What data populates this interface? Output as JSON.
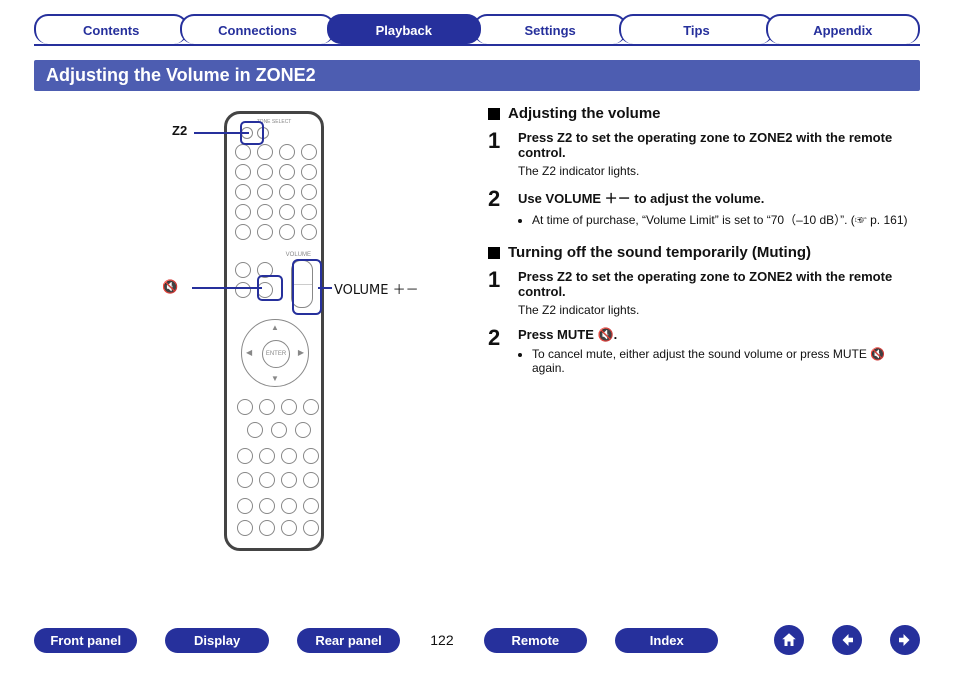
{
  "tabs": {
    "items": [
      {
        "label": "Contents",
        "active": false
      },
      {
        "label": "Connections",
        "active": false
      },
      {
        "label": "Playback",
        "active": true
      },
      {
        "label": "Settings",
        "active": false
      },
      {
        "label": "Tips",
        "active": false
      },
      {
        "label": "Appendix",
        "active": false
      }
    ]
  },
  "title": "Adjusting the Volume in ZONE2",
  "illustration": {
    "z2_label": "Z2",
    "volume_label": "VOLUME ＋－",
    "mute_glyph": "🔇"
  },
  "section_a": {
    "heading": "Adjusting the volume",
    "step1": {
      "num": "1",
      "title": "Press Z2 to set the operating zone to ZONE2 with the remote control.",
      "desc": "The Z2 indicator lights."
    },
    "step2": {
      "num": "2",
      "title": "Use VOLUME ＋－ to adjust the volume.",
      "note": "At time of purchase, “Volume Limit” is set to “70（–10 dB）”. (☞ p. 161)"
    }
  },
  "section_b": {
    "heading": "Turning off the sound temporarily (Muting)",
    "step1": {
      "num": "1",
      "title": "Press Z2 to set the operating zone to ZONE2 with the remote control.",
      "desc": "The Z2 indicator lights."
    },
    "step2": {
      "num": "2",
      "title": "Press MUTE 🔇.",
      "note": "To cancel mute, either adjust the sound volume or press MUTE 🔇 again."
    }
  },
  "footer": {
    "links": [
      {
        "label": "Front panel"
      },
      {
        "label": "Display"
      },
      {
        "label": "Rear panel"
      }
    ],
    "page": "122",
    "links2": [
      {
        "label": "Remote"
      },
      {
        "label": "Index"
      }
    ],
    "icons": {
      "home": "home-icon",
      "prev": "arrow-left-icon",
      "next": "arrow-right-icon"
    }
  }
}
